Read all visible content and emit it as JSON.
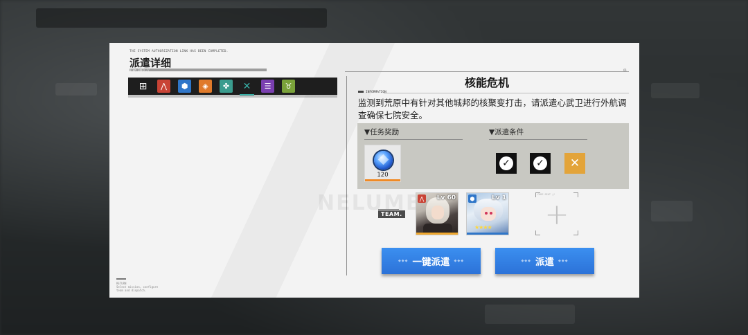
{
  "header": {
    "system_text": "THE SYSTEM AUTHORIZATION LINK HAS BEEN COMPLETED.",
    "title": "派遣详细",
    "title_sub": "ITEM INFO.//",
    "page_number": "01"
  },
  "categories": [
    {
      "name": "all",
      "icon": "grid-icon",
      "color": "#1e1e1e",
      "glyph": "⊞"
    },
    {
      "name": "faction-red",
      "icon": "red-faction-icon",
      "color": "#c94335",
      "glyph": "⋀"
    },
    {
      "name": "faction-blue",
      "icon": "blue-faction-icon",
      "color": "#2f76c9",
      "glyph": "⬢"
    },
    {
      "name": "faction-orange",
      "icon": "orange-faction-icon",
      "color": "#e07a2a",
      "glyph": "◈"
    },
    {
      "name": "faction-teal",
      "icon": "teal-faction-icon",
      "color": "#3a9c8e",
      "glyph": "✤"
    },
    {
      "name": "faction-green",
      "icon": "green-faction-icon",
      "color": "#1e1e1e",
      "glyph": "✕",
      "active": true
    },
    {
      "name": "faction-purple",
      "icon": "purple-faction-icon",
      "color": "#7a3fb0",
      "glyph": "☰"
    },
    {
      "name": "faction-lime",
      "icon": "lime-faction-icon",
      "color": "#7aa23a",
      "glyph": "♉"
    }
  ],
  "mission": {
    "name": "核能危机",
    "info_label": "INFORMATION",
    "description": "监测到荒原中有针对其他城邦的核聚变打击，请派遣心武卫进行外航调查确保七院安全。"
  },
  "rewards": {
    "heading": "▼任务奖励",
    "items": [
      {
        "icon": "crystal-gem-icon",
        "count": "120"
      }
    ]
  },
  "conditions": {
    "heading": "▼派遣条件",
    "items": [
      {
        "icon": "check-icon",
        "met": true
      },
      {
        "icon": "check-icon",
        "met": true
      },
      {
        "icon": "faction-requirement-icon",
        "met": false
      }
    ]
  },
  "team": {
    "label": "TEAM.",
    "watermark": "NELUMBO",
    "members": [
      {
        "level": "Lv 60",
        "badge_color": "#c94335",
        "badge_glyph": "⋀",
        "stripe": "#f0a82e",
        "stars": ""
      },
      {
        "level": "Lv 1",
        "badge_color": "#2f76c9",
        "badge_glyph": "⬢",
        "stripe": "#2f76c9",
        "stars": "★★★★"
      }
    ],
    "empty_slot_tag": "CORE-SEAT //"
  },
  "actions": {
    "quick_dispatch": "一键派遣",
    "dispatch": "派遣"
  },
  "footer": {
    "label": "RETURN",
    "text": "Select mission, configure team and dispatch."
  }
}
